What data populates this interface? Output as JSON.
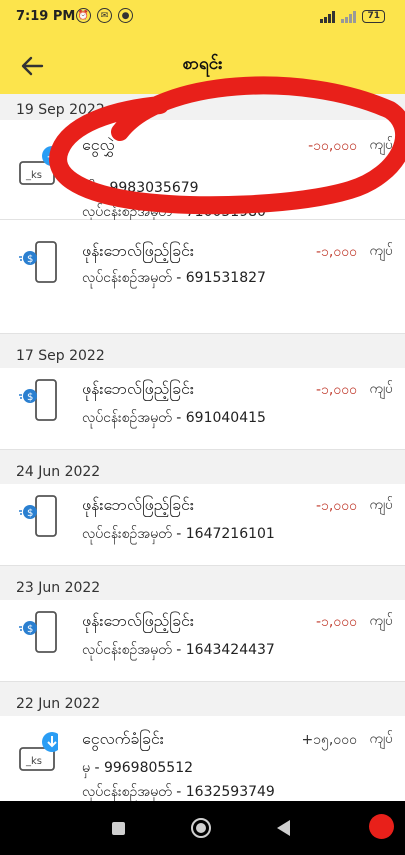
{
  "status_bar": {
    "time": "7:19 PM",
    "battery": "71",
    "icons": [
      "alarm-icon",
      "messenger-icon",
      "app-icon"
    ]
  },
  "header": {
    "title": "စာရင်း",
    "back_icon": "arrow-left-icon"
  },
  "colors": {
    "accent": "#fce44c",
    "negative_amount": "#c0392b",
    "telegram_blue": "#2a9df4",
    "annotation": "#e8201a"
  },
  "transactions": [
    {
      "date": "19 Sep 2022",
      "icon": "send-money-icon",
      "name": "ငွေလွှဲ",
      "amount": "-၁၀,၀၀၀",
      "unit": "ကျပ်",
      "line1": "သို့ - 9983035679",
      "line2": "လုပ်ငန်းစဉ်အမှတ် - 710051980"
    },
    {
      "date": "",
      "icon": "phone-topup-icon",
      "name": "ဖုန်းဘေလ်ဖြည့်ခြင်း",
      "amount": "-၁,၀၀၀",
      "unit": "ကျပ်",
      "line1": "လုပ်ငန်းစဉ်အမှတ် - 691531827"
    },
    {
      "date": "17 Sep 2022",
      "icon": "phone-topup-icon",
      "name": "ဖုန်းဘေလ်ဖြည့်ခြင်း",
      "amount": "-၁,၀၀၀",
      "unit": "ကျပ်",
      "line1": "လုပ်ငန်းစဉ်အမှတ် - 691040415"
    },
    {
      "date": "24 Jun 2022",
      "icon": "phone-topup-icon",
      "name": "ဖုန်းဘေလ်ဖြည့်ခြင်း",
      "amount": "-၁,၀၀၀",
      "unit": "ကျပ်",
      "line1": "လုပ်ငန်းစဉ်အမှတ် - 1647216101"
    },
    {
      "date": "23 Jun 2022",
      "icon": "phone-topup-icon",
      "name": "ဖုန်းဘေလ်ဖြည့်ခြင်း",
      "amount": "-၁,၀၀၀",
      "unit": "ကျပ်",
      "line1": "လုပ်ငန်းစဉ်အမှတ် - 1643424437"
    },
    {
      "date": "22 Jun 2022",
      "icon": "receive-money-icon",
      "name": "ငွေလက်ခံခြင်း",
      "amount": "+၁၅,၀၀၀",
      "unit": "ကျပ်",
      "line1": "မှ - 9969805512",
      "line2": "လုပ်ငန်းစဉ်အမှတ် - 1632593749"
    }
  ],
  "nav": {
    "icons": [
      "recents-icon",
      "home-icon",
      "back-icon",
      "floating-bubble-icon"
    ]
  }
}
